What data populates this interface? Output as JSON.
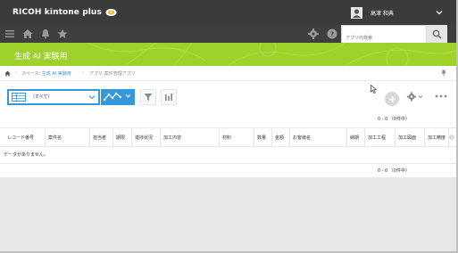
{
  "header": {
    "brand": "RICOH kintone plus",
    "user_name": "高津 和典"
  },
  "search": {
    "placeholder": "アプリ内検索"
  },
  "space": {
    "title": "生成 AI 実験用"
  },
  "breadcrumb": {
    "space_prefix": "スペース:",
    "space_name": "生成 AI 実験用",
    "app_prefix": "アプリ:",
    "app_name": "案件管理アプリ"
  },
  "view": {
    "selected": "（すべて）"
  },
  "pager": {
    "summary": "0 - 0 （0件中）"
  },
  "table": {
    "columns": [
      "レコード番号",
      "案件名",
      "担当者",
      "期限",
      "進捗状況",
      "加工内容",
      "材料",
      "数量",
      "金額",
      "お客様名",
      "納期",
      "加工工程",
      "加工図面",
      "加工精度"
    ],
    "empty_message": "データがありません。"
  },
  "icons": {
    "menu": "menu-icon",
    "home": "home-icon",
    "notification": "bell-icon",
    "favorite": "star-icon",
    "settings": "gear-icon",
    "help": "help-icon",
    "search": "search-icon",
    "filter": "filter-icon",
    "graph": "bar-chart-icon"
  },
  "colors": {
    "topbar": "#3b3b3b",
    "banner": "#9ed22a",
    "accent": "#3498db",
    "link": "#3498db"
  }
}
